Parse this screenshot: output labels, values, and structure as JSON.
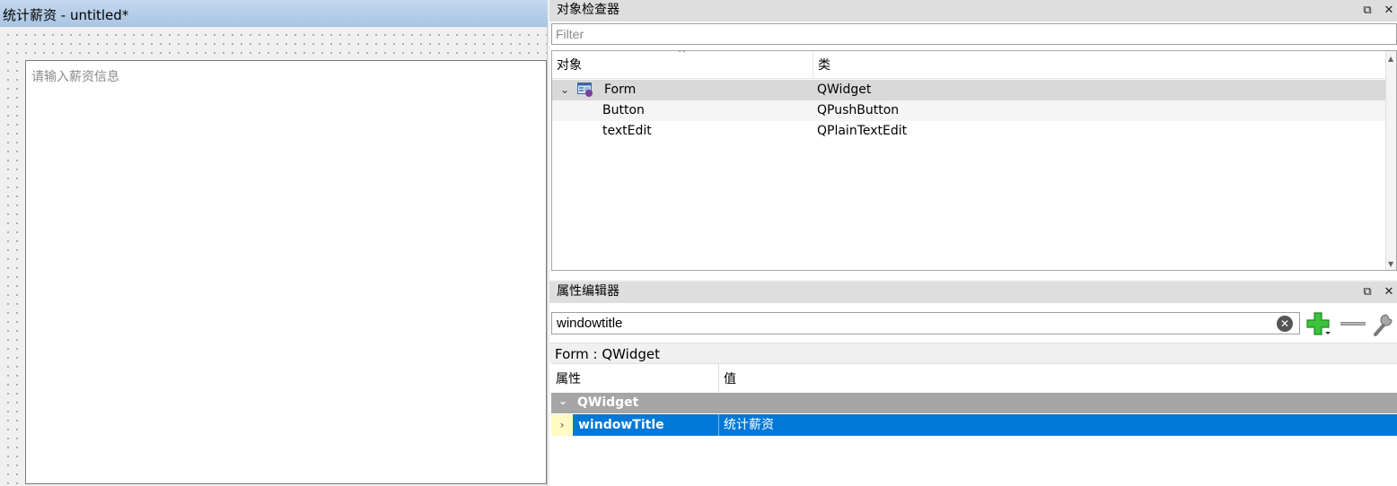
{
  "form": {
    "title": "统计薪资 - untitled*",
    "text_edit_placeholder": "请输入薪资信息"
  },
  "object_inspector": {
    "title": "对象检查器",
    "filter_placeholder": "Filter",
    "columns": [
      "对象",
      "类"
    ],
    "rows": [
      {
        "name": "Form",
        "class": "QWidget",
        "expanded": true,
        "icon": "widget-icon"
      },
      {
        "name": "Button",
        "class": "QPushButton"
      },
      {
        "name": "textEdit",
        "class": "QPlainTextEdit"
      }
    ]
  },
  "property_editor": {
    "title": "属性编辑器",
    "filter_value": "windowtitle",
    "class_label": "Form : QWidget",
    "columns": [
      "属性",
      "值"
    ],
    "group": "QWidget",
    "property": {
      "name": "windowTitle",
      "value": "统计薪资"
    }
  },
  "icons": {
    "dock_float": "float-icon",
    "dock_close": "close-icon",
    "clear": "clear-icon",
    "add": "add-icon",
    "remove": "remove-icon",
    "configure": "wrench-icon"
  },
  "colors": {
    "selection": "#0078d7",
    "group_header": "#a6a6a6",
    "titlebar": "#b5cde8"
  }
}
